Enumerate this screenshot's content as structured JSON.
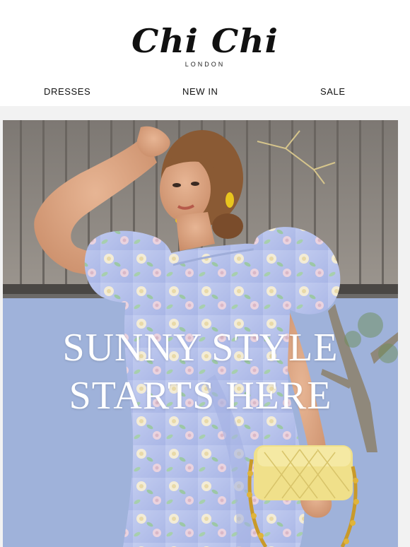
{
  "brand": {
    "name": "Chi Chi",
    "tagline": "LONDON"
  },
  "nav": {
    "items": [
      "DRESSES",
      "NEW IN",
      "SALE"
    ]
  },
  "hero": {
    "headline_line1": "SUNNY STYLE",
    "headline_line2": "STARTS HERE",
    "image_subject": "model in floral puff-sleeve dress with yellow quilted bag"
  },
  "colors": {
    "background": "#ffffff",
    "hero_frame": "#f2f2f2",
    "sky": "#8fa8d4",
    "fence": "#8a8580",
    "dress": "#b8c4ec",
    "bag": "#f0e08a",
    "text_on_hero": "#ffffff"
  }
}
